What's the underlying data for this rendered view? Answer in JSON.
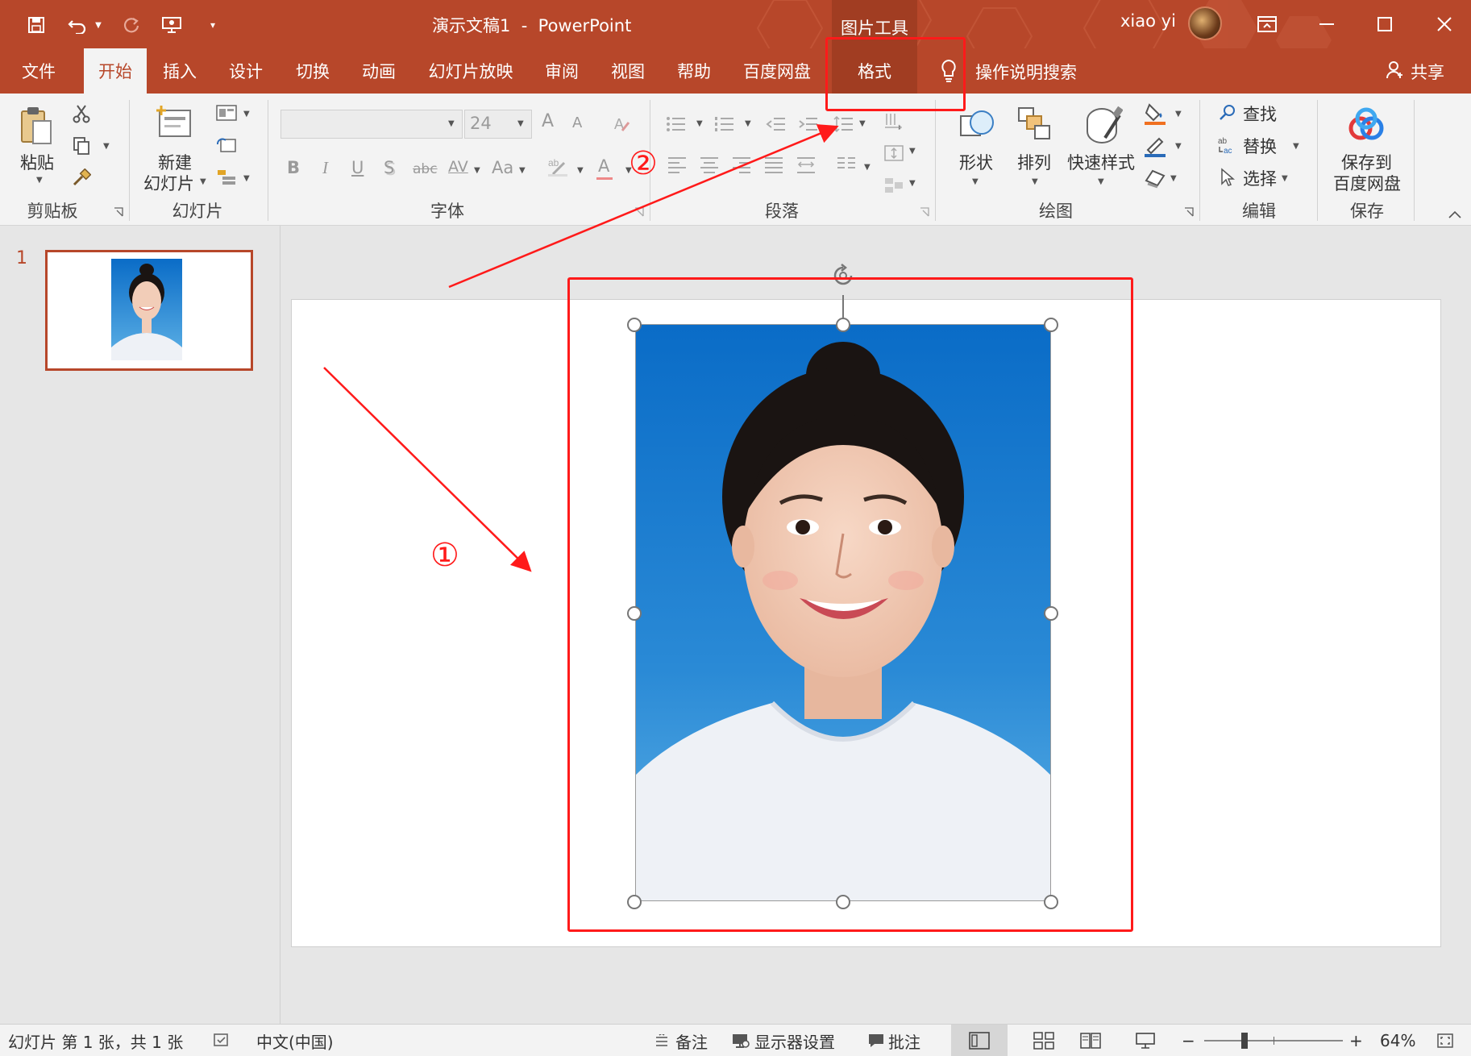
{
  "window": {
    "doc_title": "演示文稿1",
    "separator": "-",
    "app_name": "PowerPoint",
    "contextual_group": "图片工具",
    "user_name": "xiao yi"
  },
  "tabs": [
    {
      "label": "文件"
    },
    {
      "label": "开始"
    },
    {
      "label": "插入"
    },
    {
      "label": "设计"
    },
    {
      "label": "切换"
    },
    {
      "label": "动画"
    },
    {
      "label": "幻灯片放映"
    },
    {
      "label": "审阅"
    },
    {
      "label": "视图"
    },
    {
      "label": "帮助"
    },
    {
      "label": "百度网盘"
    },
    {
      "label": "格式"
    }
  ],
  "tell_me": "操作说明搜索",
  "share": "共享",
  "ribbon": {
    "clipboard": {
      "paste": "粘贴",
      "group": "剪贴板"
    },
    "slides": {
      "new_line1": "新建",
      "new_line2": "幻灯片",
      "group": "幻灯片"
    },
    "font": {
      "size": "24",
      "bold": "B",
      "italic": "I",
      "underline": "U",
      "shadow": "S",
      "strike": "abc",
      "spacing": "AV",
      "case": "Aa",
      "grow": "A",
      "shrink": "A",
      "color": "A",
      "group": "字体"
    },
    "paragraph": {
      "group": "段落"
    },
    "drawing": {
      "shapes": "形状",
      "arrange": "排列",
      "quick_styles": "快速样式",
      "group": "绘图"
    },
    "editing": {
      "find": "查找",
      "replace": "替换",
      "select": "选择",
      "group": "编辑"
    },
    "save": {
      "line1": "保存到",
      "line2": "百度网盘",
      "group": "保存"
    }
  },
  "thumbnail": {
    "number": "1"
  },
  "annotations": {
    "marker1": "①",
    "marker2": "②",
    "color": "#ff1a1a"
  },
  "status": {
    "slide_info": "幻灯片 第 1 张，共 1 张",
    "language": "中文(中国)",
    "notes": "备注",
    "display_settings": "显示器设置",
    "comments": "批注",
    "zoom_minus": "−",
    "zoom_plus": "+",
    "zoom": "64%",
    "zoom_fraction": 0.64
  },
  "colors": {
    "accent": "#b7472a",
    "ribbon_bg": "#f3f3f3",
    "photo_bg_top": "#0a6cc7",
    "photo_bg_bottom": "#5fb2e6"
  }
}
